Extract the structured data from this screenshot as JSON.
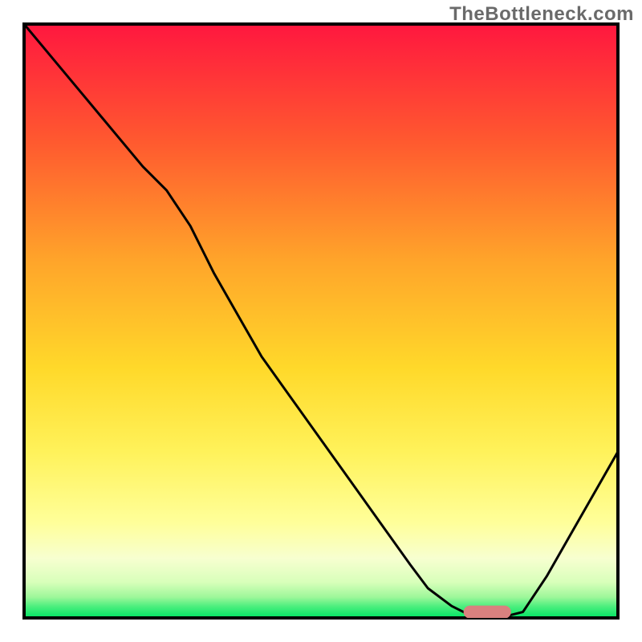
{
  "watermark": "TheBottleneck.com",
  "colors": {
    "top": "#ff173f",
    "mid_upper": "#ff8a2a",
    "mid": "#ffd92a",
    "mid_lower": "#ffff8a",
    "band_pale": "#f3ffe0",
    "bottom": "#00e463",
    "frame": "#000000",
    "curve": "#000000",
    "marker": "#d9817f"
  },
  "chart_data": {
    "type": "line",
    "title": "",
    "xlabel": "",
    "ylabel": "",
    "xlim": [
      0,
      100
    ],
    "ylim": [
      0,
      100
    ],
    "grid": false,
    "legend": false,
    "series": [
      {
        "name": "bottleneck-curve",
        "x": [
          0,
          5,
          10,
          15,
          20,
          24,
          28,
          32,
          36,
          40,
          45,
          50,
          55,
          60,
          65,
          68,
          72,
          76,
          80,
          84,
          88,
          92,
          96,
          100
        ],
        "y": [
          100,
          94,
          88,
          82,
          76,
          72,
          66,
          58,
          51,
          44,
          37,
          30,
          23,
          16,
          9,
          5,
          2,
          0,
          0,
          1,
          7,
          14,
          21,
          28
        ]
      }
    ],
    "marker": {
      "name": "recommended-range",
      "x_start": 74,
      "x_end": 82,
      "y": 1
    },
    "notes": "No numeric axis ticks are rendered; values are relative (0–100)."
  }
}
